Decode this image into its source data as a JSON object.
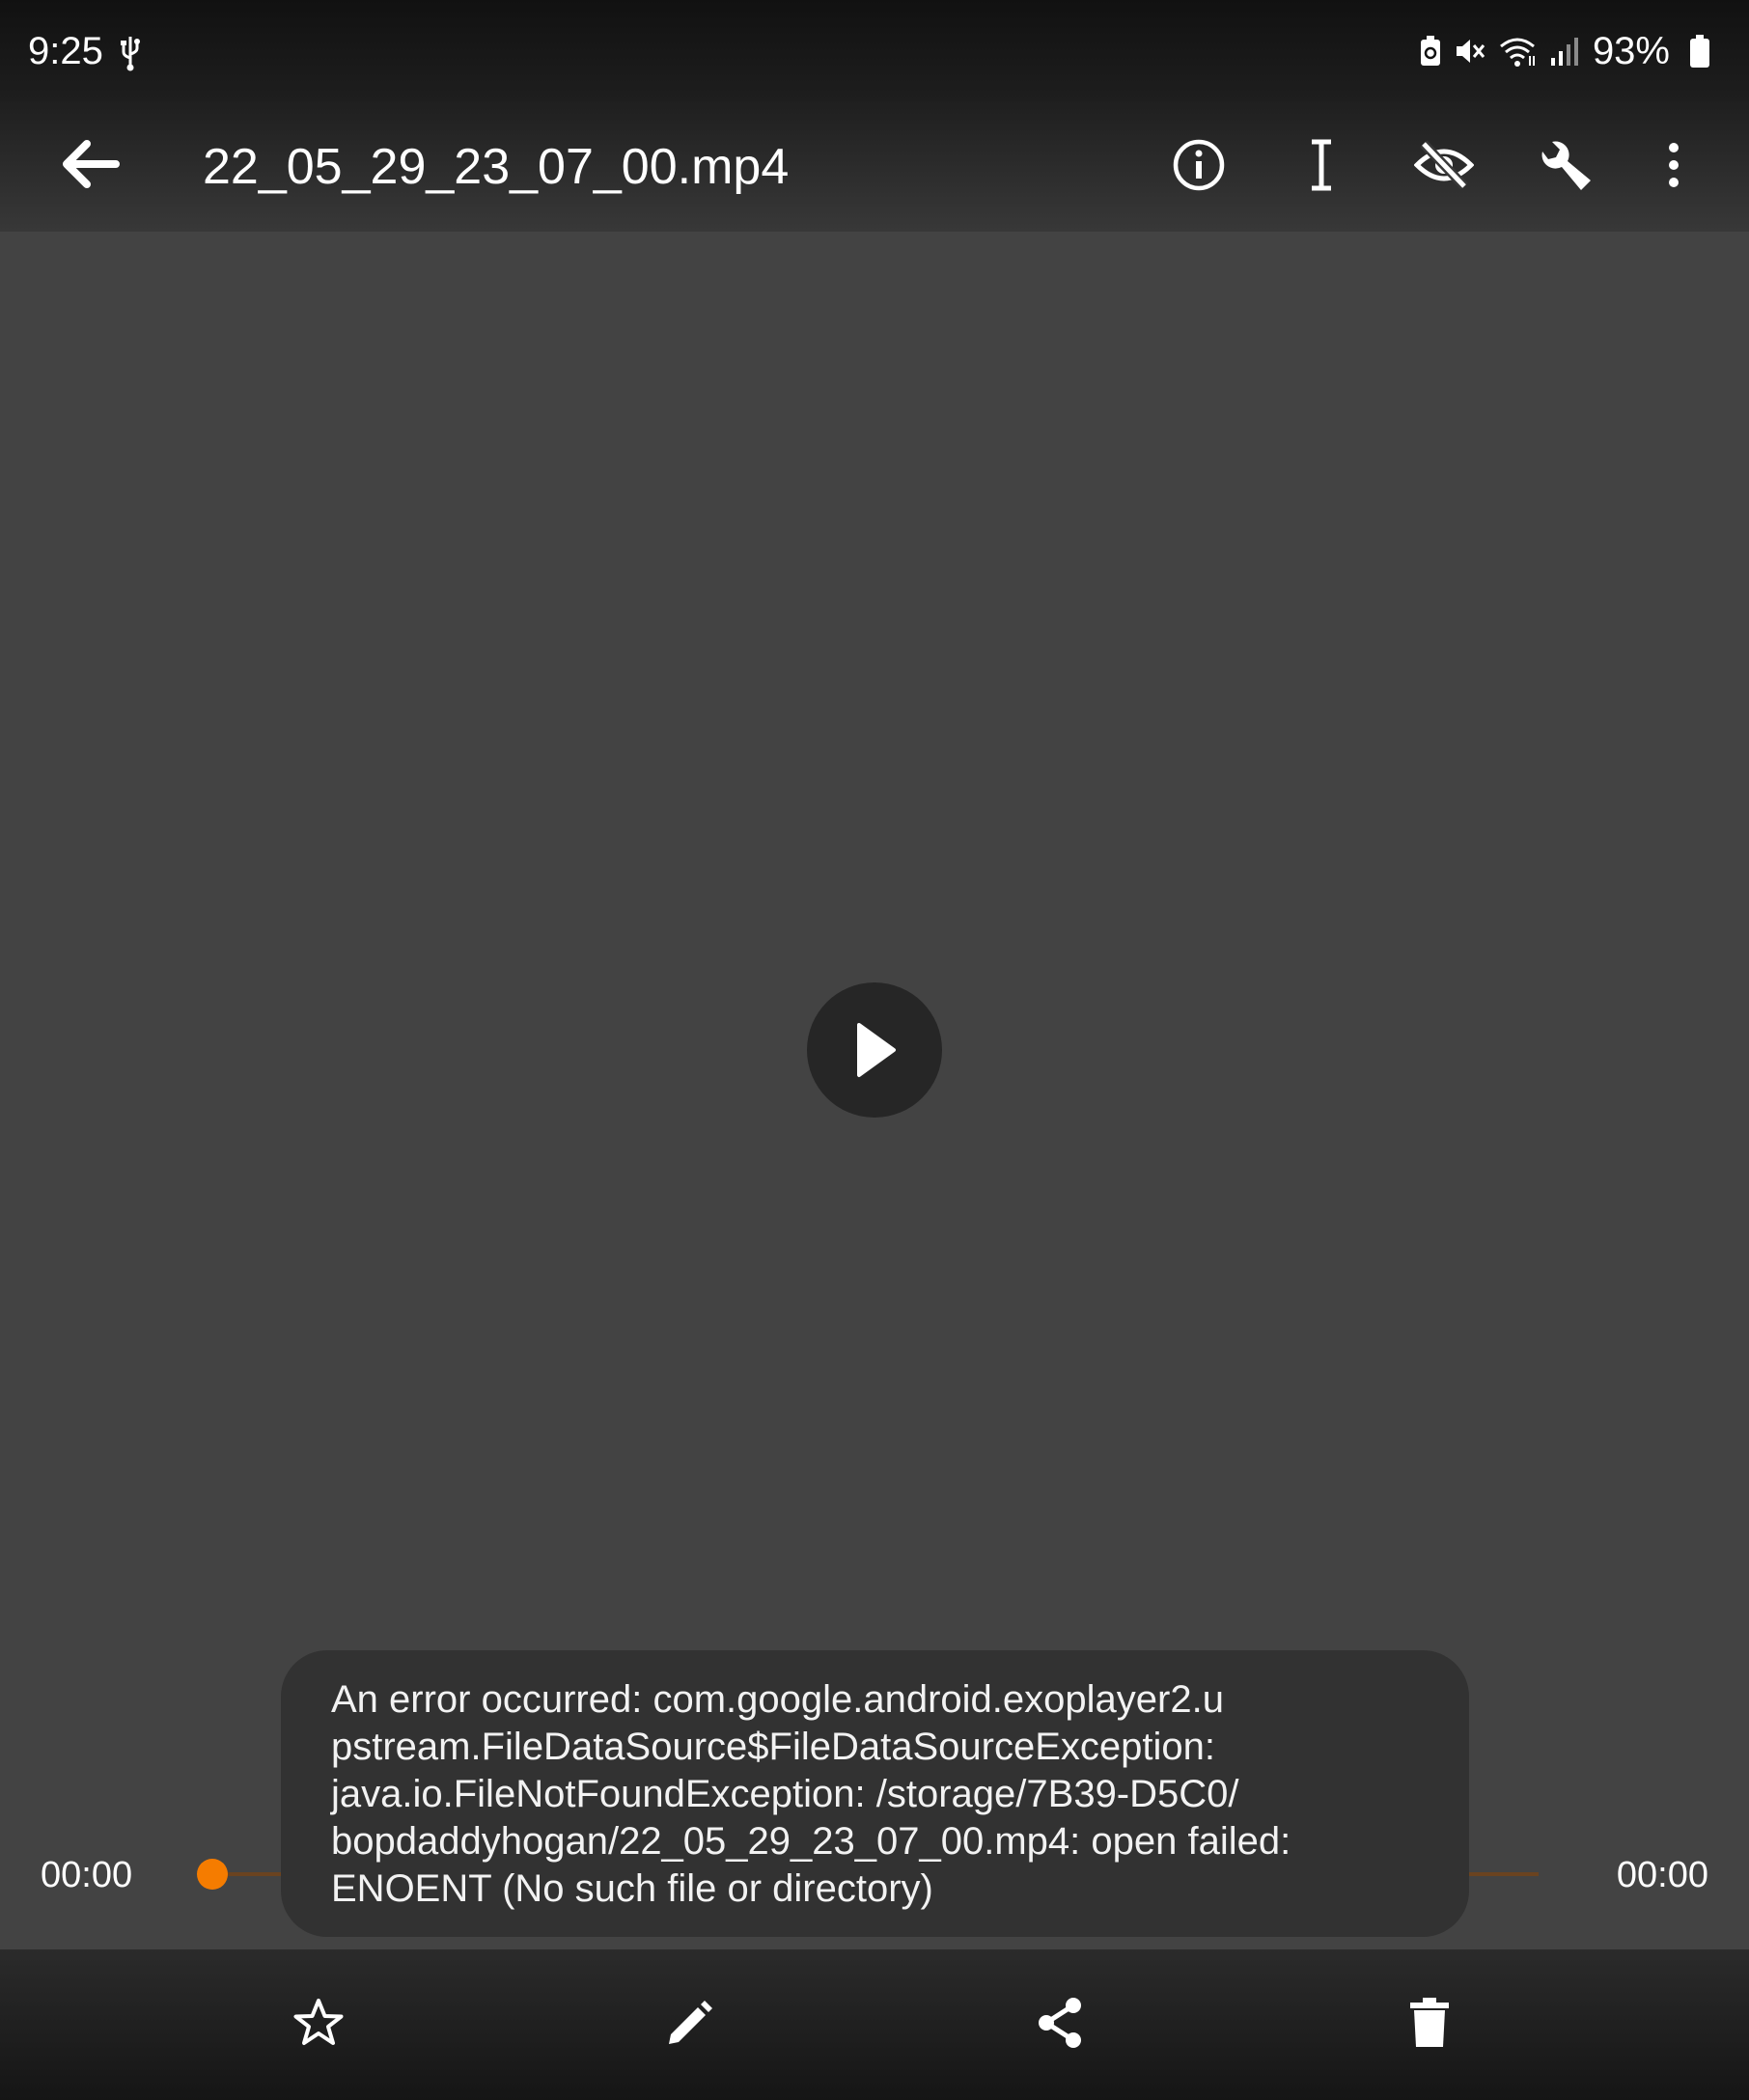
{
  "status_bar": {
    "time": "9:25",
    "battery_percent": "93%",
    "icons": [
      "usb-icon",
      "battery-saver-icon",
      "mute-icon",
      "wifi-icon",
      "signal-icon",
      "battery-icon"
    ]
  },
  "app_bar": {
    "title": "22_05_29_23_07_00.mp4",
    "icons": [
      "back-arrow-icon",
      "info-icon",
      "text-cursor-icon",
      "visibility-off-icon",
      "wrench-icon",
      "more-vert-icon"
    ]
  },
  "player": {
    "current_time": "00:00",
    "total_time": "00:00",
    "progress": 0,
    "accent_color": "#f57c00",
    "play_icon": "play-icon"
  },
  "toast": {
    "message": "An error occurred: com.google.android.exoplayer2.u\npstream.FileDataSource$FileDataSourceException:\njava.io.FileNotFoundException: /storage/7B39-D5C0/\nbopdaddyhogan/22_05_29_23_07_00.mp4: open failed:\nENOENT (No such file or directory)"
  },
  "bottom_bar": {
    "icons": [
      "star-outline-icon",
      "edit-icon",
      "share-icon",
      "delete-icon"
    ]
  }
}
